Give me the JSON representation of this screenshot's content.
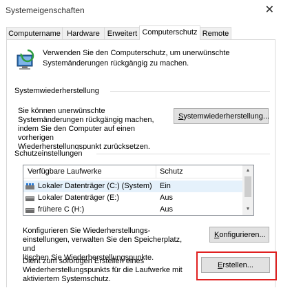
{
  "window": {
    "title": "Systemeigenschaften",
    "close_glyph": "✕"
  },
  "tabs": [
    {
      "label": "Computername"
    },
    {
      "label": "Hardware"
    },
    {
      "label": "Erweitert"
    },
    {
      "label": "Computerschutz"
    },
    {
      "label": "Remote"
    }
  ],
  "intro": {
    "line1": "Verwenden Sie den Computerschutz, um unerwünschte",
    "line2": "Systemänderungen rückgängig zu machen.",
    "icon": "computer-protection-icon"
  },
  "restore": {
    "heading": "Systemwiederherstellung",
    "text": [
      "Sie können unerwünschte",
      "Systemänderungen rückgängig machen,",
      "indem Sie den Computer auf einen vorherigen",
      "Wiederherstellungspunkt zurücksetzen."
    ],
    "button_mnemonic": "S",
    "button_rest": "ystemwiederherstellung..."
  },
  "protection": {
    "heading": "Schutzeinstellungen",
    "columns": {
      "drives": "Verfügbare Laufwerke",
      "protection": "Schutz"
    },
    "rows": [
      {
        "drive": "Lokaler Datenträger (C:) (System)",
        "status": "Ein",
        "icon": "system-drive-icon"
      },
      {
        "drive": "Lokaler Datenträger (E:)",
        "status": "Aus",
        "icon": "drive-icon"
      },
      {
        "drive": "frühere C (H:)",
        "status": "Aus",
        "icon": "drive-icon"
      }
    ]
  },
  "configure": {
    "text": [
      "Konfigurieren Sie Wiederherstellungs-",
      "einstellungen, verwalten Sie den Speicherplatz, und",
      "löschen Sie Wiederherstellungspunkte."
    ],
    "button_mnemonic": "K",
    "button_rest": "onfigurieren..."
  },
  "create": {
    "text": [
      "Dient zum sofortigen Erstellen eines",
      "Wiederherstellungspunkts für die Laufwerke mit",
      "aktiviertem Systemschutz."
    ],
    "button_mnemonic": "E",
    "button_rest": "rstellen..."
  },
  "colors": {
    "highlight": "#e02020",
    "selected_row": "#e5f1fb",
    "button_bg": "#e1e1e1"
  }
}
